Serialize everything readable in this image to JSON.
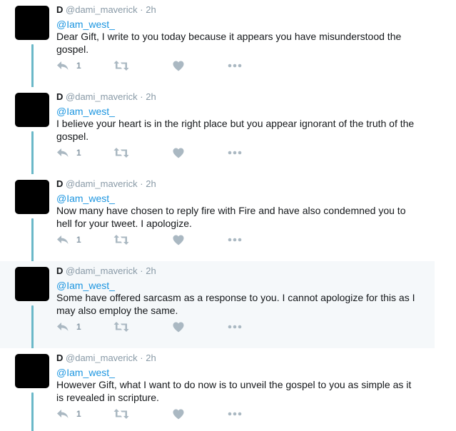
{
  "tweets": [
    {
      "name": "D",
      "handle": "@dami_maverick",
      "separator": "·",
      "time": "2h",
      "mention": "@Iam_west_",
      "text": "Dear Gift, I write to you today because it appears you have misunderstood the gospel.",
      "reply_count": "1",
      "highlighted": false
    },
    {
      "name": "D",
      "handle": "@dami_maverick",
      "separator": "·",
      "time": "2h",
      "mention": "@Iam_west_",
      "text": "I believe your heart is in the right place but you appear ignorant of the truth of the gospel.",
      "reply_count": "1",
      "highlighted": false
    },
    {
      "name": "D",
      "handle": "@dami_maverick",
      "separator": "·",
      "time": "2h",
      "mention": "@Iam_west_",
      "text": "Now many have chosen to reply fire with Fire and have also condemned you to hell for your tweet. I apologize.",
      "reply_count": "1",
      "highlighted": false
    },
    {
      "name": "D",
      "handle": "@dami_maverick",
      "separator": "·",
      "time": "2h",
      "mention": "@Iam_west_",
      "text": "Some have offered sarcasm as a response to you. I cannot apologize for this as I may also employ the same.",
      "reply_count": "1",
      "highlighted": true
    },
    {
      "name": "D",
      "handle": "@dami_maverick",
      "separator": "·",
      "time": "2h",
      "mention": "@Iam_west_",
      "text": "However Gift, what I want to do now is to unveil the gospel to you as simple as it is revealed in scripture.",
      "reply_count": "1",
      "highlighted": false
    }
  ],
  "icons": {
    "reply": "reply-icon",
    "retweet": "retweet-icon",
    "like": "heart-icon",
    "more": "more-dots-icon"
  },
  "colors": {
    "mention": "#1b95e0",
    "muted": "#8899a6",
    "thread_line": "#6ab8c8",
    "highlight_bg": "#f5f8fa",
    "avatar": "#000000"
  }
}
